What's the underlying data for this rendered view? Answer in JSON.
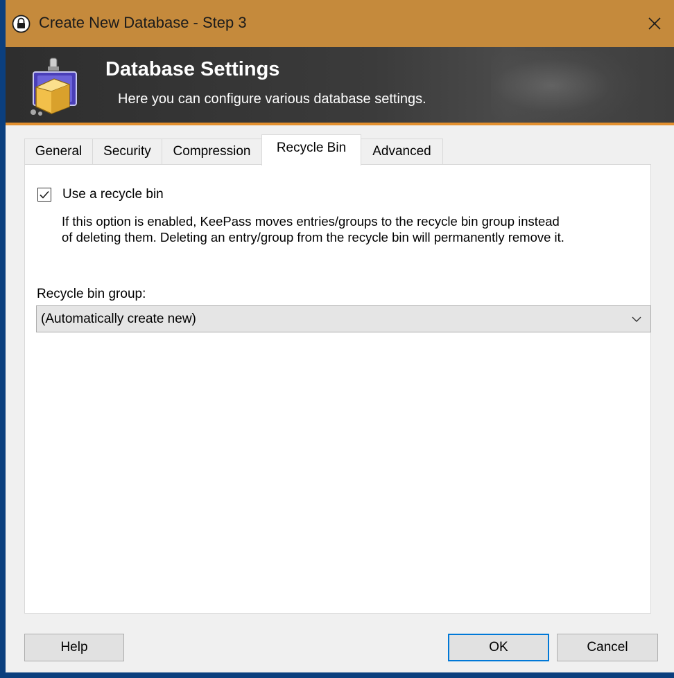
{
  "window": {
    "title": "Create New Database - Step 3",
    "title_icon": "keepass-lock-icon",
    "close_icon": "close-icon"
  },
  "banner": {
    "title": "Database Settings",
    "subtitle": "Here you can configure various database settings.",
    "icon": "database-icon"
  },
  "tabs": [
    {
      "label": "General",
      "active": false
    },
    {
      "label": "Security",
      "active": false
    },
    {
      "label": "Compression",
      "active": false
    },
    {
      "label": "Recycle Bin",
      "active": true
    },
    {
      "label": "Advanced",
      "active": false
    }
  ],
  "recycle_bin": {
    "use_label": "Use a recycle bin",
    "use_checked": true,
    "description_lines": [
      "If this option is enabled, KeePass moves entries/groups to the recycle bin group instead",
      "of deleting them. Deleting an entry/group from the recycle bin will permanently remove it."
    ],
    "group_label": "Recycle bin group:",
    "group_value": "(Automatically create new)"
  },
  "buttons": {
    "help": "Help",
    "ok": "OK",
    "cancel": "Cancel"
  },
  "colors": {
    "titlebar": "#c58a3c",
    "accent_stripe": "#e3902f",
    "default_button_border": "#0078d7",
    "desktop": "#0b3f7e"
  }
}
